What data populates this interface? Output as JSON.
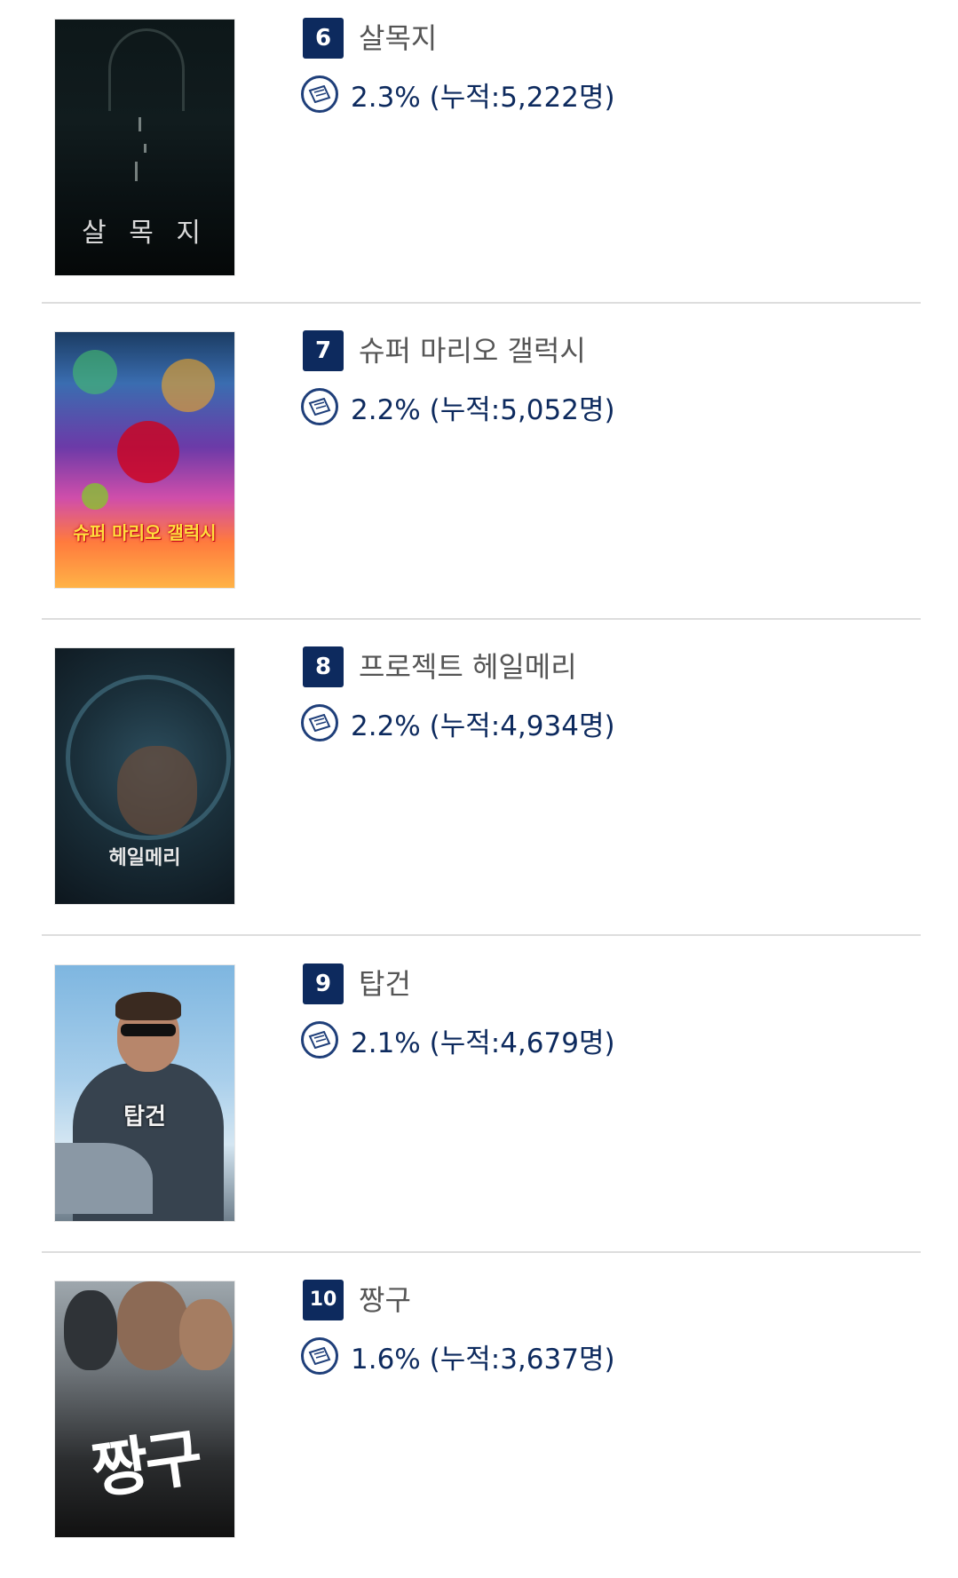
{
  "movies": [
    {
      "rank": "6",
      "title": "살목지",
      "share": "2.3%",
      "cumulative": "(누적:5,222명)",
      "poster_title": "살 목 지",
      "icon": "ticket-icon"
    },
    {
      "rank": "7",
      "title": "슈퍼 마리오 갤럭시",
      "share": "2.2%",
      "cumulative": "(누적:5,052명)",
      "poster_title": "슈퍼 마리오 갤럭시",
      "icon": "ticket-icon"
    },
    {
      "rank": "8",
      "title": "프로젝트 헤일메리",
      "share": "2.2%",
      "cumulative": "(누적:4,934명)",
      "poster_title": "헤일메리",
      "icon": "ticket-icon"
    },
    {
      "rank": "9",
      "title": "탑건",
      "share": "2.1%",
      "cumulative": "(누적:4,679명)",
      "poster_title": "탑건",
      "icon": "ticket-icon"
    },
    {
      "rank": "10",
      "title": "짱구",
      "share": "1.6%",
      "cumulative": "(누적:3,637명)",
      "poster_title": "짱구",
      "icon": "ticket-icon"
    }
  ],
  "colors": {
    "badge": "#0d2a5e",
    "title": "#555555",
    "stat": "#0d2a5e",
    "divider": "#dddddd"
  }
}
